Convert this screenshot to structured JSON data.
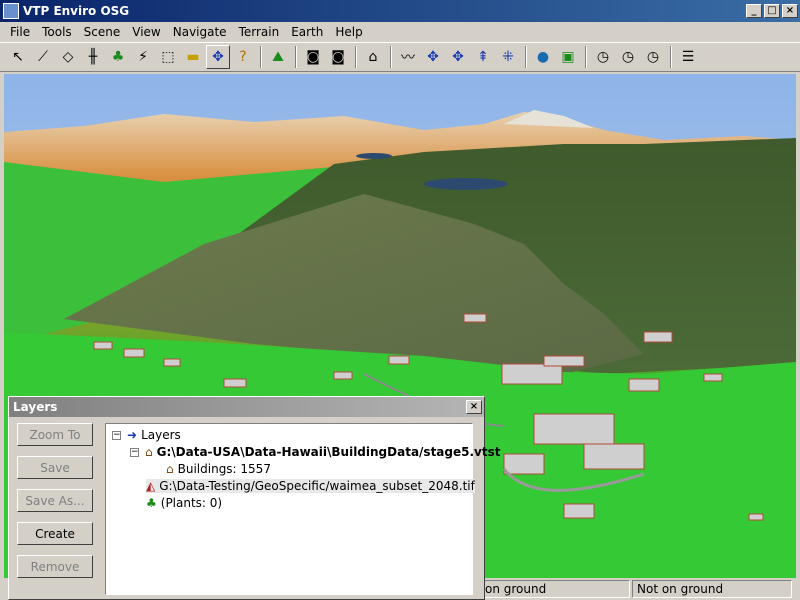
{
  "window": {
    "title": "VTP Enviro OSG"
  },
  "menu": [
    "File",
    "Tools",
    "Scene",
    "View",
    "Navigate",
    "Terrain",
    "Earth",
    "Help"
  ],
  "toolbar": {
    "icons": [
      "pointer-icon",
      "path-icon",
      "terrain-edit-icon",
      "fence-icon",
      "tree-icon",
      "route-icon",
      "select-area-icon",
      "vehicle-icon",
      "move-icon",
      "info-icon",
      "profile-icon",
      "camera-icon",
      "camera-nav-icon",
      "building-icon",
      "elevation-icon",
      "zoom-in-icon",
      "zoom-out-icon",
      "level-icon",
      "spread-icon",
      "globe-icon",
      "map-icon",
      "clock-icon",
      "clock-play-icon",
      "clock-stop-icon",
      "tree-view-icon"
    ]
  },
  "status": {
    "left": "on ground",
    "right": "Not on ground"
  },
  "layers_dialog": {
    "title": "Layers",
    "buttons": {
      "zoom_to": "Zoom To",
      "save": "Save",
      "save_as": "Save As...",
      "create": "Create",
      "remove": "Remove"
    },
    "tree": {
      "root": "Layers",
      "structure_file": "G:\\Data-USA\\Data-Hawaii\\BuildingData/stage5.vtst",
      "buildings": "Buildings: 1557",
      "image_file": "G:\\Data-Testing/GeoSpecific/waimea_subset_2048.tif",
      "plants": "(Plants: 0)"
    }
  },
  "colors": {
    "title_active": "#0a246a",
    "sky": "#a7c2e6",
    "grass": "#35c936",
    "dialog": "#d4d0c8"
  }
}
